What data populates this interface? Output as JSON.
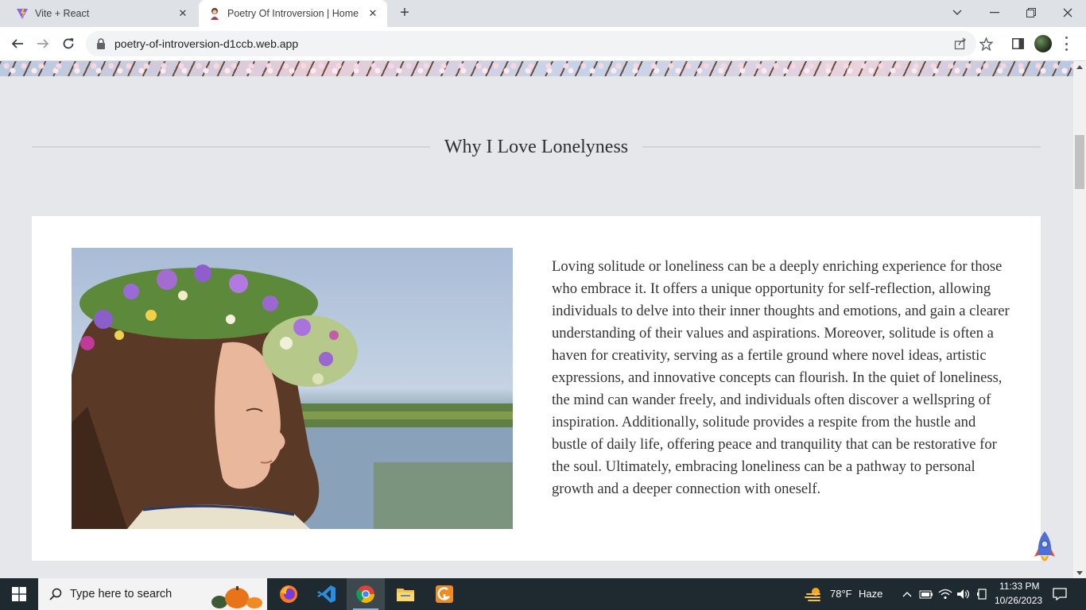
{
  "browser": {
    "tabs": [
      {
        "title": "Vite + React",
        "active": false
      },
      {
        "title": "Poetry Of Introversion | Home",
        "active": true
      }
    ],
    "url": "poetry-of-introversion-d1ccb.web.app"
  },
  "page": {
    "section_title": "Why I Love Lonelyness",
    "paragraph": "Loving solitude or loneliness can be a deeply enriching experience for those who embrace it. It offers a unique opportunity for self-reflection, allowing individuals to delve into their inner thoughts and emotions, and gain a clearer understanding of their values and aspirations. Moreover, solitude is often a haven for creativity, serving as a fertile ground where novel ideas, artistic expressions, and innovative concepts can flourish. In the quiet of loneliness, the mind can wander freely, and individuals often discover a wellspring of inspiration. Additionally, solitude provides a respite from the hustle and bustle of daily life, offering peace and tranquility that can be restorative for the soul. Ultimately, embracing loneliness can be a pathway to personal growth and a deeper connection with oneself."
  },
  "taskbar": {
    "search_placeholder": "Type here to search",
    "weather_temp": "78°F",
    "weather_desc": "Haze",
    "time": "11:33 PM",
    "date": "10/26/2023"
  },
  "colors": {
    "page_bg": "#e6e7eb",
    "card_bg": "#ffffff",
    "taskbar_bg": "#1f2a30"
  }
}
